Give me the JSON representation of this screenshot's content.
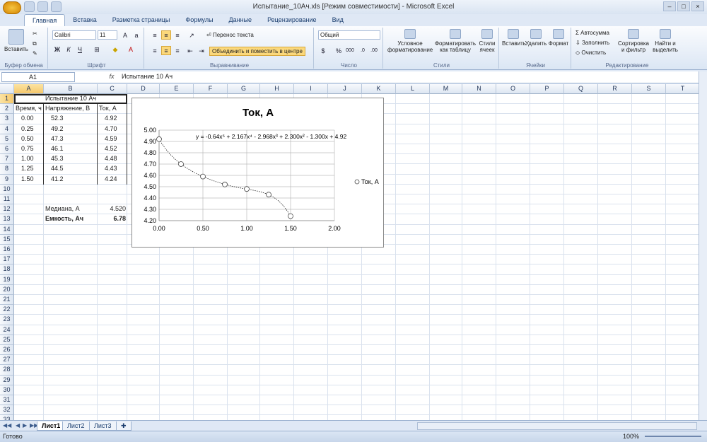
{
  "window": {
    "title": "Испытание_10Ач.xls  [Режим совместимости] - Microsoft Excel"
  },
  "tabs": [
    "Главная",
    "Вставка",
    "Разметка страницы",
    "Формулы",
    "Данные",
    "Рецензирование",
    "Вид"
  ],
  "ribbon": {
    "clipboard": {
      "paste": "Вставить",
      "label": "Буфер обмена"
    },
    "font": {
      "name": "Calibri",
      "size": "11",
      "label": "Шрифт"
    },
    "alignment": {
      "wrap": "Перенос текста",
      "merge": "Объединить и поместить в центре",
      "label": "Выравнивание"
    },
    "number": {
      "format": "Общий",
      "label": "Число"
    },
    "styles": {
      "cond1": "Условное",
      "cond2": "форматирование",
      "table1": "Форматировать",
      "table2": "как таблицу",
      "cell1": "Стили",
      "cell2": "ячеек",
      "label": "Стили"
    },
    "cells": {
      "insert": "Вставить",
      "delete": "Удалить",
      "format": "Формат",
      "label": "Ячейки"
    },
    "editing": {
      "autosum": "Автосумма",
      "fill": "Заполнить",
      "clear": "Очистить",
      "sort1": "Сортировка",
      "sort2": "и фильтр",
      "find1": "Найти и",
      "find2": "выделить",
      "label": "Редактирование"
    }
  },
  "formula_bar": {
    "cell": "A1",
    "fx": "fx",
    "content": "Испытание 10 Ач"
  },
  "columns": [
    "A",
    "B",
    "C",
    "D",
    "E",
    "F",
    "G",
    "H",
    "I",
    "J",
    "K",
    "L",
    "M",
    "N",
    "O",
    "P",
    "Q",
    "R",
    "S",
    "T"
  ],
  "rows": [
    "1",
    "2",
    "3",
    "4",
    "5",
    "6",
    "7",
    "8",
    "9",
    "10",
    "11",
    "12",
    "13",
    "14",
    "15",
    "16",
    "17",
    "18",
    "19",
    "20",
    "21",
    "22",
    "23",
    "24",
    "25",
    "26",
    "27",
    "28",
    "29",
    "30",
    "31",
    "32",
    "33"
  ],
  "sheet": {
    "title": "Испытание 10 Ач",
    "headers": [
      "Время, ч",
      "Напряжение, В",
      "Ток, А"
    ],
    "data": [
      [
        "0.00",
        "52.3",
        "4.92"
      ],
      [
        "0.25",
        "49.2",
        "4.70"
      ],
      [
        "0.50",
        "47.3",
        "4.59"
      ],
      [
        "0.75",
        "46.1",
        "4.52"
      ],
      [
        "1.00",
        "45.3",
        "4.48"
      ],
      [
        "1.25",
        "44.5",
        "4.43"
      ],
      [
        "1.50",
        "41.2",
        "4.24"
      ]
    ],
    "median_label": "Медиана, А",
    "median_value": "4.520",
    "capacity_label": "Емкость, Ач",
    "capacity_value": "6.78"
  },
  "chart_data": {
    "type": "scatter",
    "title": "Ток, А",
    "x": [
      0.0,
      0.25,
      0.5,
      0.75,
      1.0,
      1.25,
      1.5
    ],
    "series": [
      {
        "name": "Ток, А",
        "values": [
          4.92,
          4.7,
          4.59,
          4.52,
          4.48,
          4.43,
          4.24
        ]
      }
    ],
    "trendline": "y = -0.64x⁵ + 2.167x⁴ - 2.968x³ + 2.300x² - 1.300x + 4.92",
    "xlim": [
      0,
      2
    ],
    "ylim": [
      4.2,
      5.0
    ],
    "x_ticks": [
      "0.00",
      "0.50",
      "1.00",
      "1.50",
      "2.00"
    ],
    "y_ticks": [
      "4.20",
      "4.30",
      "4.40",
      "4.50",
      "4.60",
      "4.70",
      "4.80",
      "4.90",
      "5.00"
    ],
    "legend": "right",
    "grid": true
  },
  "sheet_tabs": [
    "Лист1",
    "Лист2",
    "Лист3"
  ],
  "status": {
    "ready": "Готово",
    "zoom": "100%"
  }
}
